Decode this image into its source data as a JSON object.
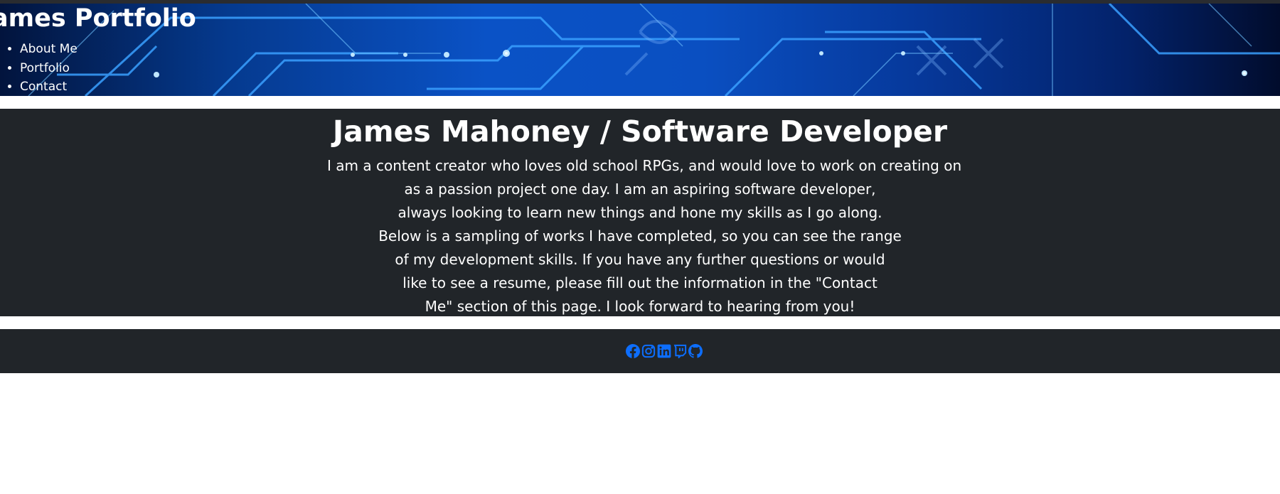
{
  "header": {
    "site_title": "ames Portfolio",
    "nav": [
      {
        "label": "About Me"
      },
      {
        "label": "Portfolio"
      },
      {
        "label": "Contact"
      }
    ]
  },
  "about": {
    "heading": "James Mahoney / Software Developer",
    "lines": [
      "I am a content creator who loves old school RPGs, and would love to work on creating on",
      "as a passion project one day. I am an aspiring software developer,",
      "always looking to learn new things and hone my skills as I go along.",
      "Below is a sampling of works I have completed, so you can see the range",
      "of my development skills. If you have any further questions or would",
      "like to see a resume, please fill out the information in the \"Contact",
      "Me\" section of this page. I look forward to hearing from you!"
    ]
  },
  "footer": {
    "icons": [
      "facebook-icon",
      "instagram-icon",
      "linkedin-icon",
      "twitch-icon",
      "github-icon"
    ],
    "icon_color": "#0d6efd"
  },
  "colors": {
    "dark_section": "#212529",
    "header_blue": "#0a52c6"
  }
}
